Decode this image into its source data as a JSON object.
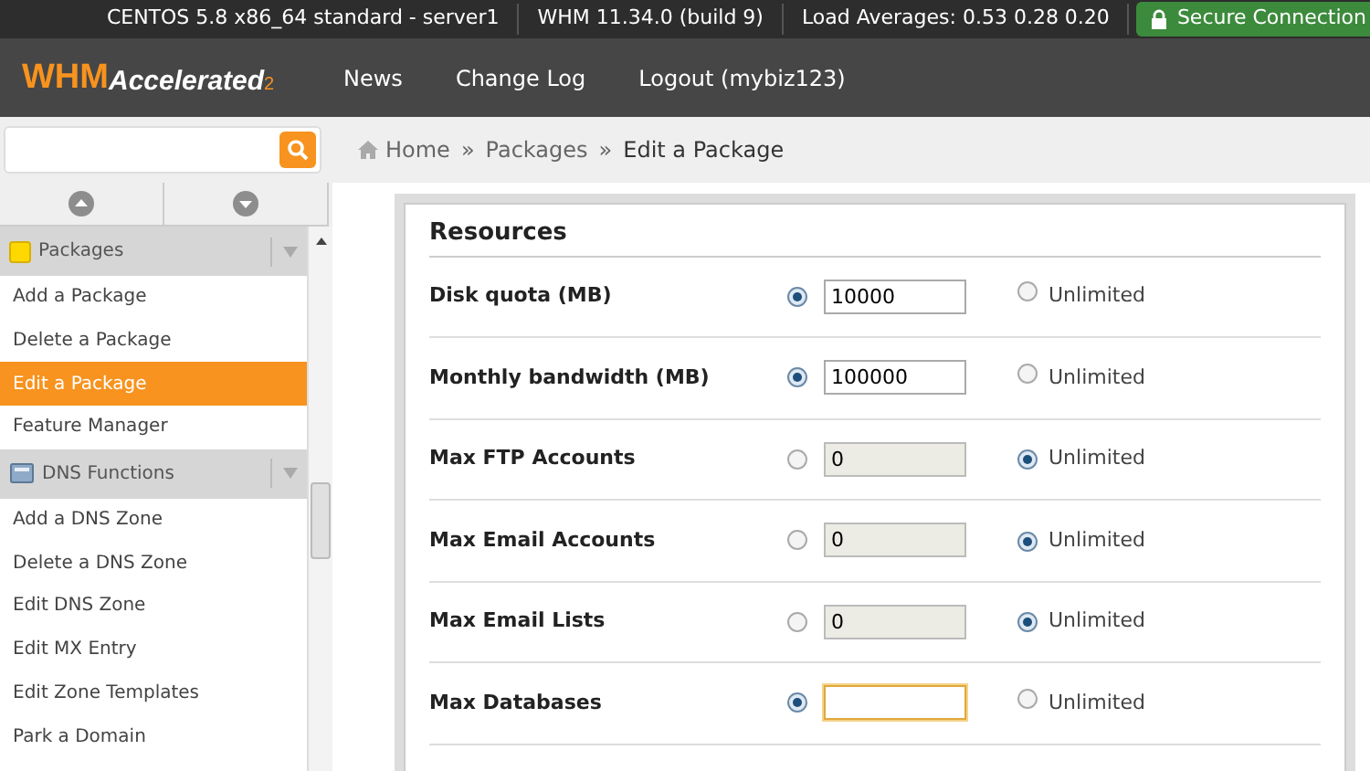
{
  "status_bar": {
    "items": [
      "CENTOS 5.8 x86_64 standard - server1",
      "WHM 11.34.0 (build 9)",
      "Load Averages: 0.53 0.28 0.20"
    ],
    "secure": "Secure Connection"
  },
  "header": {
    "logo_main": "WHM",
    "logo_sub": "Accelerated",
    "logo_sup": "2",
    "nav": [
      "News",
      "Change Log",
      "Logout (mybiz123)"
    ]
  },
  "breadcrumb": [
    {
      "kind": "link",
      "text": "Home"
    },
    {
      "kind": "separator",
      "text": "»"
    },
    {
      "kind": "link",
      "text": "Packages"
    },
    {
      "kind": "separator",
      "text": "»"
    },
    {
      "kind": "current",
      "text": "Edit a Package"
    }
  ],
  "sidebar": {
    "groups": [
      {
        "kind": "packages",
        "title": "Packages",
        "items": [
          {
            "label": "Add a Package",
            "selected": false
          },
          {
            "label": "Delete a Package",
            "selected": false
          },
          {
            "label": "Edit a Package",
            "selected": true
          },
          {
            "label": "Feature Manager",
            "selected": false
          }
        ]
      },
      {
        "kind": "dns",
        "title": "DNS Functions",
        "items": [
          {
            "label": "Add a DNS Zone",
            "selected": false
          },
          {
            "label": "Delete a DNS Zone",
            "selected": false
          },
          {
            "label": "Edit DNS Zone",
            "selected": false
          },
          {
            "label": "Edit MX Entry",
            "selected": false
          },
          {
            "label": "Edit Zone Templates",
            "selected": false
          },
          {
            "label": "Park a Domain",
            "selected": false
          }
        ]
      }
    ]
  },
  "form": {
    "title": "Resources",
    "rows": [
      {
        "label": "Disk quota (MB)",
        "value": "10000",
        "unlimited": false,
        "focused": false,
        "unlimited_label": "Unlimited"
      },
      {
        "label": "Monthly bandwidth (MB)",
        "value": "100000",
        "unlimited": false,
        "focused": false,
        "unlimited_label": "Unlimited"
      },
      {
        "label": "Max FTP Accounts",
        "value": "0",
        "unlimited": true,
        "focused": false,
        "unlimited_label": "Unlimited"
      },
      {
        "label": "Max Email Accounts",
        "value": "0",
        "unlimited": true,
        "focused": false,
        "unlimited_label": "Unlimited"
      },
      {
        "label": "Max Email Lists",
        "value": "0",
        "unlimited": true,
        "focused": false,
        "unlimited_label": "Unlimited"
      },
      {
        "label": "Max Databases",
        "value": "",
        "unlimited": false,
        "focused": true,
        "unlimited_label": "Unlimited"
      }
    ]
  }
}
